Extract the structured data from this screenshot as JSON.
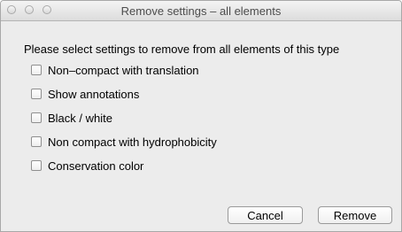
{
  "window": {
    "title": "Remove settings – all elements"
  },
  "dialog": {
    "prompt": "Please select settings to remove from all elements of this type",
    "options": [
      {
        "label": "Non–compact with translation",
        "checked": false
      },
      {
        "label": "Show annotations",
        "checked": false
      },
      {
        "label": "Black / white",
        "checked": false
      },
      {
        "label": "Non compact with hydrophobicity",
        "checked": false
      },
      {
        "label": "Conservation color",
        "checked": false
      }
    ],
    "cancel_label": "Cancel",
    "remove_label": "Remove"
  }
}
